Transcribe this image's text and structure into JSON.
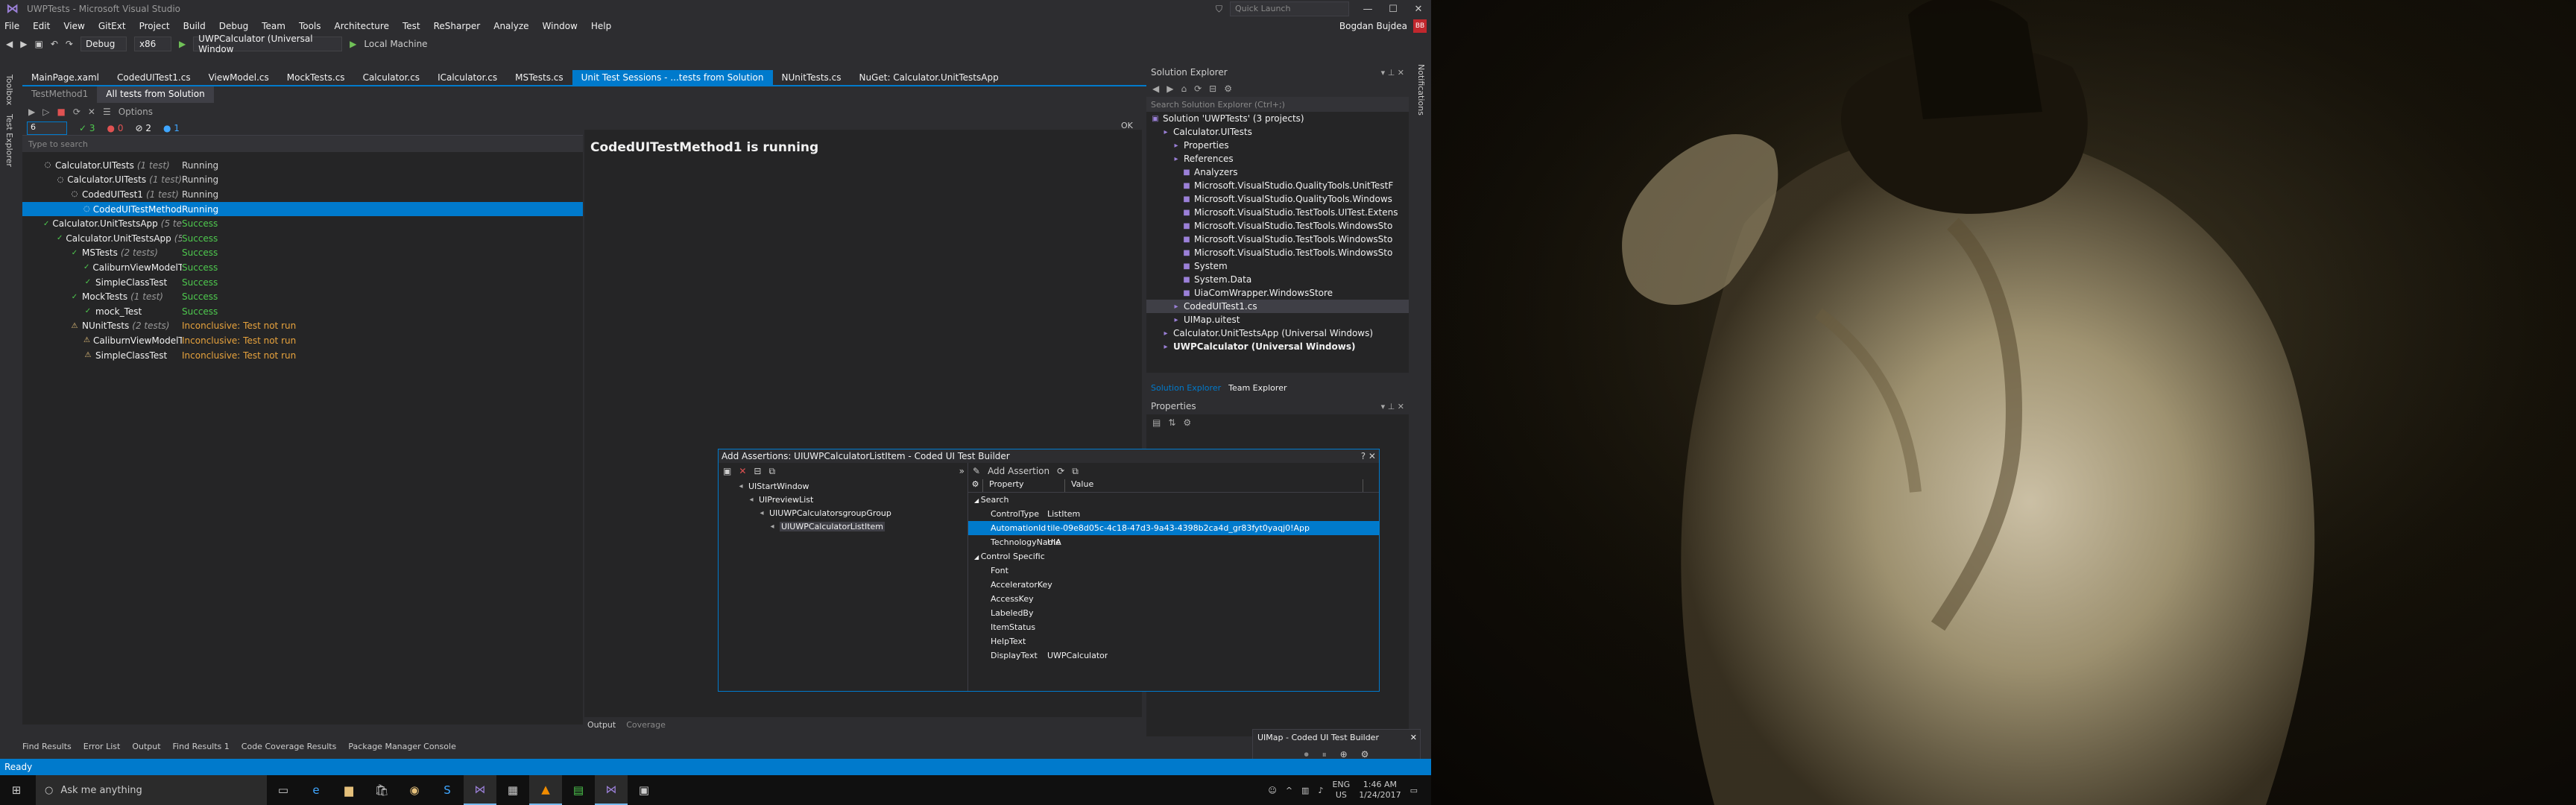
{
  "window": {
    "title": "UWPTests - Microsoft Visual Studio",
    "quick_launch": "Quick Launch"
  },
  "menu": [
    "File",
    "Edit",
    "View",
    "GitExt",
    "Project",
    "Build",
    "Debug",
    "Team",
    "Tools",
    "Architecture",
    "Test",
    "ReSharper",
    "Analyze",
    "Window",
    "Help"
  ],
  "user": {
    "name": "Bogdan Bujdea",
    "initials": "BB"
  },
  "toolbar": {
    "config": "Debug",
    "platform": "x86",
    "startup": "UWPCalculator (Universal Window",
    "target": "Local Machine"
  },
  "doc_tabs": [
    "MainPage.xaml",
    "CodedUITest1.cs",
    "ViewModel.cs",
    "MockTests.cs",
    "Calculator.cs",
    "ICalculator.cs",
    "MSTests.cs",
    "Unit Test Sessions - ...tests from Solution",
    "NUnitTests.cs",
    "NuGet: Calculator.UnitTestsApp"
  ],
  "left_tabs": [
    "Toolbox",
    "Test Explorer"
  ],
  "session_tabs": [
    "TestMethod1",
    "All tests from Solution"
  ],
  "filter": {
    "search_value": "6",
    "passed": "3",
    "failed": "0",
    "ignored": "2",
    "info": "1",
    "options": "Options"
  },
  "search_placeholder": "Type to search",
  "tests": [
    {
      "name": "Calculator.UITests",
      "count": "(1 test)",
      "status": "Running",
      "indent": 1,
      "kind": "running"
    },
    {
      "name": "Calculator.UITests",
      "count": "(1 test)",
      "status": "Running",
      "indent": 2,
      "kind": "running"
    },
    {
      "name": "CodedUITest1",
      "count": "(1 test)",
      "status": "Running",
      "indent": 3,
      "kind": "running"
    },
    {
      "name": "CodedUITestMethod1",
      "count": "",
      "status": "Running",
      "indent": 4,
      "kind": "running",
      "selected": true
    },
    {
      "name": "Calculator.UnitTestsApp",
      "count": "(5 tests)",
      "status": "Success",
      "indent": 1,
      "kind": "success"
    },
    {
      "name": "Calculator.UnitTestsApp",
      "count": "(5 tests)",
      "status": "Success",
      "indent": 2,
      "kind": "success"
    },
    {
      "name": "MSTests",
      "count": "(2 tests)",
      "status": "Success",
      "indent": 3,
      "kind": "success"
    },
    {
      "name": "CaliburnViewModelTest",
      "count": "",
      "status": "Success",
      "indent": 4,
      "kind": "success"
    },
    {
      "name": "SimpleClassTest",
      "count": "",
      "status": "Success",
      "indent": 4,
      "kind": "success"
    },
    {
      "name": "MockTests",
      "count": "(1 test)",
      "status": "Success",
      "indent": 3,
      "kind": "success"
    },
    {
      "name": "mock_Test",
      "count": "",
      "status": "Success",
      "indent": 4,
      "kind": "success"
    },
    {
      "name": "NUnitTests",
      "count": "(2 tests)",
      "status": "Inconclusive: Test not run",
      "indent": 3,
      "kind": "inconc"
    },
    {
      "name": "CaliburnViewModelTest",
      "count": "",
      "status": "Inconclusive: Test not run",
      "indent": 4,
      "kind": "inconc"
    },
    {
      "name": "SimpleClassTest",
      "count": "",
      "status": "Inconclusive: Test not run",
      "indent": 4,
      "kind": "inconc"
    }
  ],
  "detail": {
    "heading": "CodedUITestMethod1 is running",
    "ok": "OK"
  },
  "output_tabs": [
    "Output",
    "Coverage"
  ],
  "bottom_tabs": [
    "Find Results",
    "Error List",
    "Output",
    "Find Results 1",
    "Code Coverage Results",
    "Package Manager Console"
  ],
  "status": "Ready",
  "solution_explorer": {
    "title": "Solution Explorer",
    "search_placeholder": "Search Solution Explorer (Ctrl+;)",
    "items": [
      {
        "text": "Solution 'UWPTests' (3 projects)",
        "indent": 0
      },
      {
        "text": "Calculator.UITests",
        "indent": 1
      },
      {
        "text": "Properties",
        "indent": 2
      },
      {
        "text": "References",
        "indent": 2
      },
      {
        "text": "Analyzers",
        "indent": 3
      },
      {
        "text": "Microsoft.VisualStudio.QualityTools.UnitTestF",
        "indent": 3
      },
      {
        "text": "Microsoft.VisualStudio.QualityTools.Windows",
        "indent": 3
      },
      {
        "text": "Microsoft.VisualStudio.TestTools.UITest.Extens",
        "indent": 3
      },
      {
        "text": "Microsoft.VisualStudio.TestTools.WindowsSto",
        "indent": 3
      },
      {
        "text": "Microsoft.VisualStudio.TestTools.WindowsSto",
        "indent": 3
      },
      {
        "text": "Microsoft.VisualStudio.TestTools.WindowsSto",
        "indent": 3
      },
      {
        "text": "System",
        "indent": 3
      },
      {
        "text": "System.Data",
        "indent": 3
      },
      {
        "text": "UiaComWrapper.WindowsStore",
        "indent": 3
      },
      {
        "text": "CodedUITest1.cs",
        "indent": 2,
        "selected": true
      },
      {
        "text": "UIMap.uitest",
        "indent": 2
      },
      {
        "text": "Calculator.UnitTestsApp (Universal Windows)",
        "indent": 1
      },
      {
        "text": "UWPCalculator (Universal Windows)",
        "indent": 1,
        "bold": true
      }
    ],
    "tabs": [
      "Solution Explorer",
      "Team Explorer"
    ]
  },
  "properties": {
    "title": "Properties"
  },
  "right_tabs": [
    "Notifications"
  ],
  "dialog": {
    "title": "Add Assertions: UIUWPCalculatorListItem - Coded UI Test Builder",
    "add_assertion": "Add Assertion",
    "hierarchy": [
      "UIStartWindow",
      "UIPreviewList",
      "UIUWPCalculatorsgroupGroup",
      "UIUWPCalculatorListItem"
    ],
    "col_property": "Property",
    "col_value": "Value",
    "rows": [
      {
        "k": "Search",
        "v": "",
        "cat": true
      },
      {
        "k": "ControlType",
        "v": "ListItem"
      },
      {
        "k": "AutomationId",
        "v": "tile-09e8d05c-4c18-47d3-9a43-4398b2ca4d_gr83fyt0yaqj0!App",
        "selected": true
      },
      {
        "k": "TechnologyName",
        "v": "UIA"
      },
      {
        "k": "Control Specific",
        "v": "",
        "cat": true
      },
      {
        "k": "Font",
        "v": ""
      },
      {
        "k": "AcceleratorKey",
        "v": ""
      },
      {
        "k": "AccessKey",
        "v": ""
      },
      {
        "k": "LabeledBy",
        "v": ""
      },
      {
        "k": "ItemStatus",
        "v": ""
      },
      {
        "k": "HelpText",
        "v": ""
      },
      {
        "k": "DisplayText",
        "v": "UWPCalculator"
      }
    ]
  },
  "uimap": {
    "title": "UIMap - Coded UI Test Builder"
  },
  "taskbar": {
    "search": "Ask me anything",
    "lang": "ENG",
    "region": "US",
    "time": "1:46 AM",
    "date": "1/24/2017"
  },
  "colors": {
    "accent": "#007acc",
    "success": "#4ec94e",
    "inconclusive": "#e8a33d",
    "bg": "#2d2d30",
    "panel": "#252526"
  }
}
